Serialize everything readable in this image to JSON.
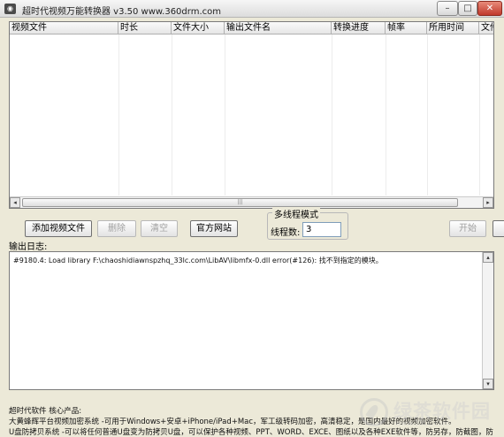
{
  "window": {
    "app_icon": "app-logo-icon",
    "title": "超时代视频万能转换器 v3.50   www.360drm.com",
    "minimize": "–",
    "maximize": "□",
    "close": "✕"
  },
  "table": {
    "columns": [
      "视频文件",
      "时长",
      "文件大小",
      "输出文件名",
      "转换进度",
      "帧率",
      "所用时间",
      "文件"
    ],
    "rows": [],
    "scroll_left": "◂",
    "scroll_right": "▸",
    "scroll_thumb": "|||"
  },
  "toolbar": {
    "add_video": "添加视频文件",
    "delete": "删除",
    "clear": "清空",
    "official_site": "官方网站",
    "multithread_group": "多线程模式",
    "thread_count_label": "线程数:",
    "thread_count_value": "3",
    "start": "开始"
  },
  "log": {
    "label": "输出日志:",
    "lines": [
      "#9180.4: Load library F:\\chaoshidiawnspzhq_33lc.com\\LibAV\\libmfx-0.dll error(#126): 找不到指定的模块。"
    ],
    "scroll_up": "▴",
    "scroll_down": "▾"
  },
  "footer": {
    "heading": "超时代软件 核心产品:",
    "line1": "大黄蜂辉平台视频加密系统 -可用于Windows+安卓+iPhone/iPad+Mac，军工级转码加密，高清稳定，是国内最好的视频加密软件。",
    "line2": "U盘防拷贝系统 -可以将任何普通U盘变为防拷贝U盘，可以保护各种视频、PPT、WORD、EXCE、图纸以及各种EXE软件等，防另存，防截图，防"
  },
  "watermark": {
    "text": "绿茶软件园",
    "url": "www.33LC.com"
  }
}
